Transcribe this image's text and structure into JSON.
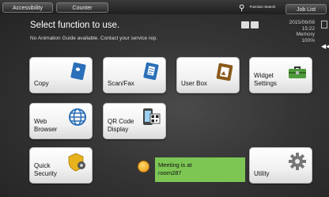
{
  "topbar": {
    "accessibility_label": "Accessibility",
    "counter_label": "Counter",
    "function_search_label": "Function Search",
    "job_list_label": "Job List"
  },
  "header": {
    "title": "Select function to use.",
    "notice": "No Animation Guide available. Contact your service rep."
  },
  "status": {
    "date": "2015/06/08",
    "time": "15:22",
    "memory_label": "Memory",
    "memory_value": "100%"
  },
  "tiles": {
    "copy": "Copy",
    "scan_fax": "Scan/Fax",
    "user_box": "User Box",
    "widget_settings_1": "Widget",
    "widget_settings_2": "Settings",
    "web_browser_1": "Web",
    "web_browser_2": "Browser",
    "qr_code_1": "QR Code",
    "qr_code_2": "Display",
    "quick_security_1": "Quick",
    "quick_security_2": "Security",
    "utility": "Utility"
  },
  "message": {
    "line1": "Meeting is at",
    "line2": "room287"
  },
  "icons": {
    "copy": "copy-icon",
    "scan": "scan-fax-icon",
    "userbox": "user-box-icon",
    "widget": "toolbox-icon",
    "web": "globe-icon",
    "qr": "qr-code-icon",
    "security": "shield-key-icon",
    "utility": "gear-icon",
    "message": "memo-icon"
  },
  "colors": {
    "accent_blue": "#2a6fb8",
    "message_bg": "#7dc654"
  }
}
